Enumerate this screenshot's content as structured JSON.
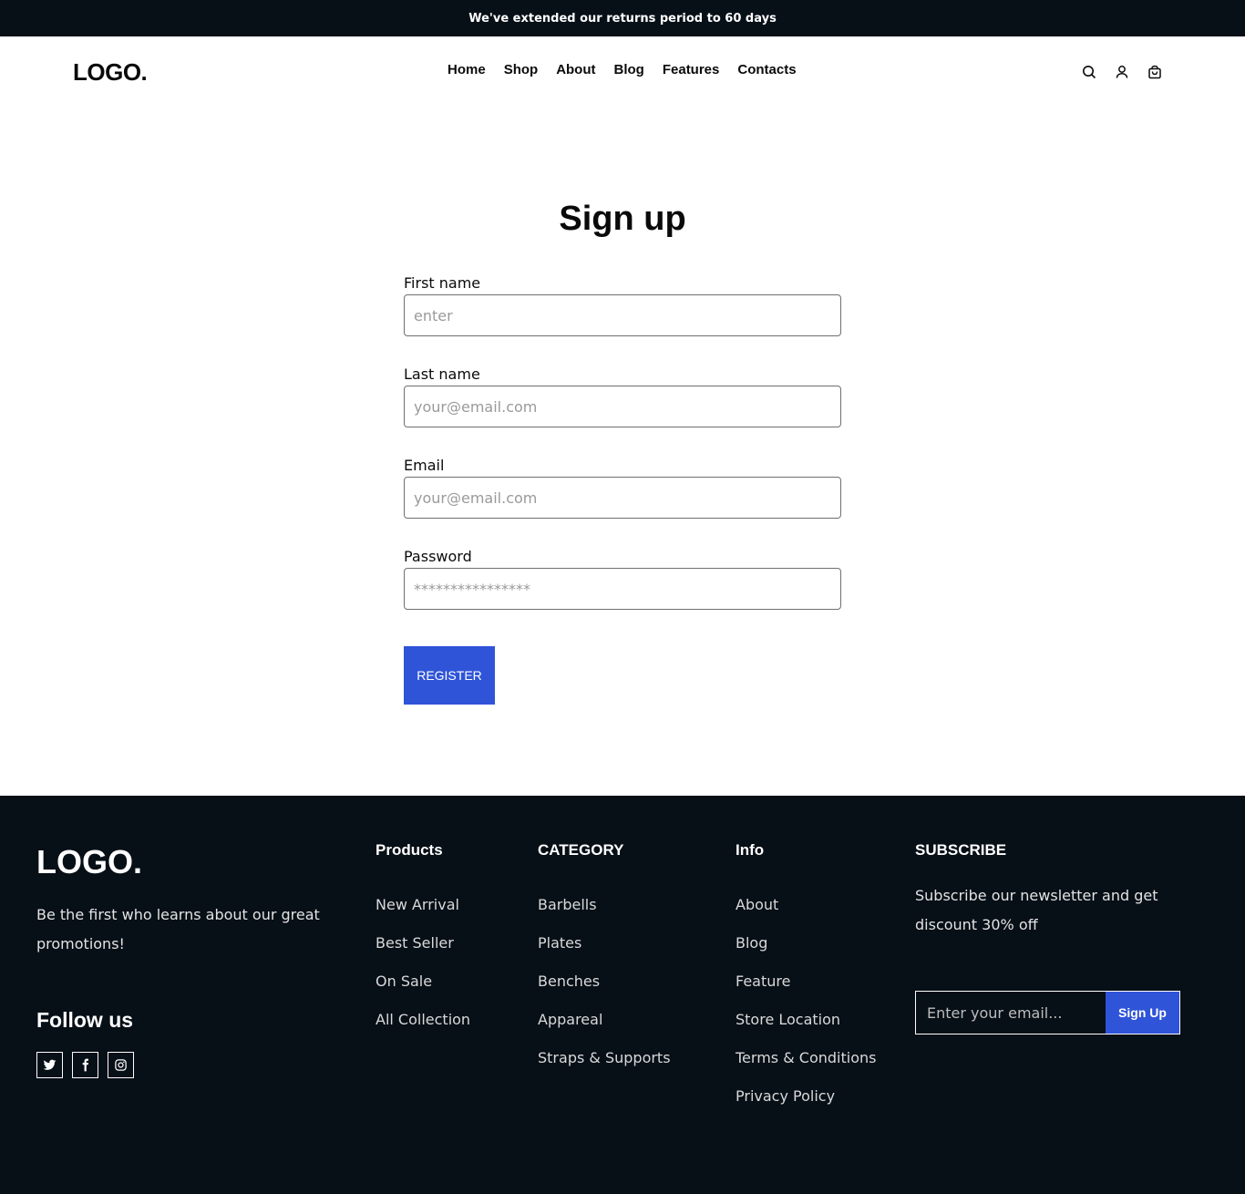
{
  "announcement": "We've extended our returns period to 60 days",
  "header": {
    "logo": "LOGO.",
    "nav": [
      "Home",
      "Shop",
      "About",
      "Blog",
      "Features",
      "Contacts"
    ],
    "icons": [
      "search-icon",
      "user-icon",
      "cart-icon"
    ]
  },
  "signup": {
    "title": "Sign up",
    "fields": [
      {
        "label": "First name",
        "placeholder": "enter"
      },
      {
        "label": "Last name",
        "placeholder": "your@email.com"
      },
      {
        "label": "Email",
        "placeholder": "your@email.com"
      },
      {
        "label": "Password",
        "placeholder": "****************"
      }
    ],
    "register_label": "REGISTER"
  },
  "footer": {
    "logo": "LOGO.",
    "tagline": "Be the first who learns about our great promotions!",
    "follow_title": "Follow us",
    "socials": [
      "twitter-icon",
      "facebook-icon",
      "instagram-icon"
    ],
    "products": {
      "title": "Products",
      "items": [
        "New Arrival",
        "Best Seller",
        "On Sale",
        "All Collection"
      ]
    },
    "category": {
      "title": "CATEGORY",
      "items": [
        "Barbells",
        "Plates",
        "Benches",
        "Appareal",
        "Straps & Supports"
      ]
    },
    "info": {
      "title": "Info",
      "items": [
        "About",
        "Blog",
        "Feature",
        "Store Location",
        "Terms & Conditions",
        "Privacy Policy"
      ]
    },
    "subscribe": {
      "title": "SUBSCRIBE",
      "text": "Subscribe our newsletter and get discount 30% off",
      "placeholder": "Enter your email...",
      "button": "Sign Up"
    }
  },
  "colors": {
    "dark": "#070f17",
    "accent": "#2f54d8"
  }
}
